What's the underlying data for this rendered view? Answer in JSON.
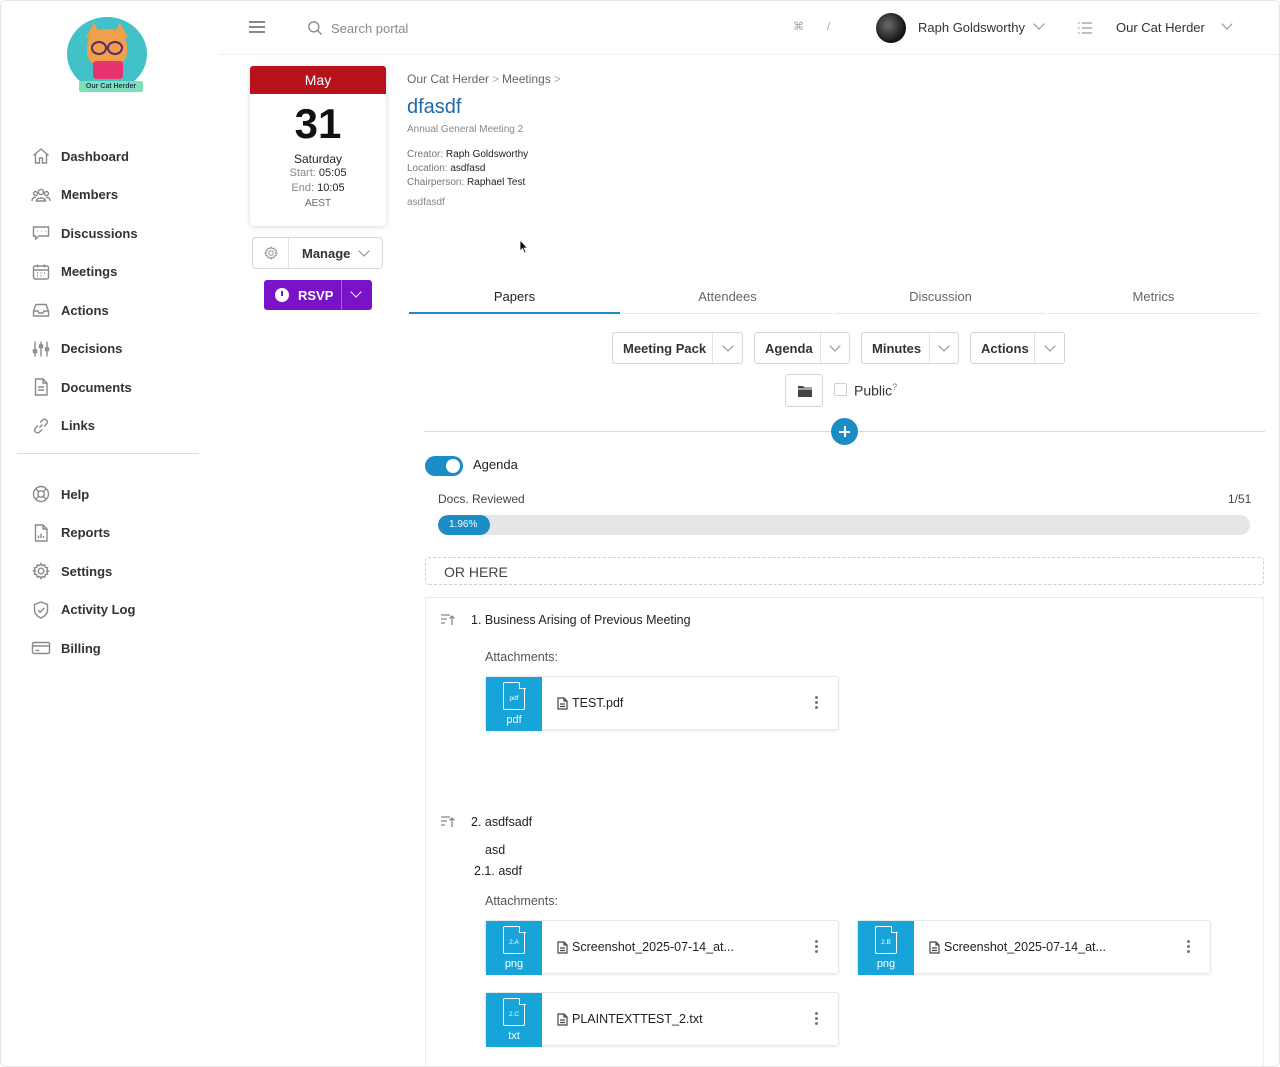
{
  "app": {
    "name": "Our Cat Herder"
  },
  "topbar": {
    "search_placeholder": "Search portal",
    "shortcut": "⌘ /",
    "user_name": "Raph Goldsworthy",
    "org_name": "Our Cat Herder"
  },
  "sidebar": {
    "logo_text": "Our Cat Herder",
    "primary": [
      {
        "label": "Dashboard",
        "icon": "home-icon"
      },
      {
        "label": "Members",
        "icon": "members-icon"
      },
      {
        "label": "Discussions",
        "icon": "chat-icon"
      },
      {
        "label": "Meetings",
        "icon": "calendar-icon"
      },
      {
        "label": "Actions",
        "icon": "inbox-icon"
      },
      {
        "label": "Decisions",
        "icon": "sliders-icon"
      },
      {
        "label": "Documents",
        "icon": "document-icon"
      },
      {
        "label": "Links",
        "icon": "link-icon"
      }
    ],
    "secondary": [
      {
        "label": "Help",
        "icon": "lifebuoy-icon"
      },
      {
        "label": "Reports",
        "icon": "report-icon"
      },
      {
        "label": "Settings",
        "icon": "gear-icon"
      },
      {
        "label": "Activity Log",
        "icon": "shield-icon"
      },
      {
        "label": "Billing",
        "icon": "credit-card-icon"
      }
    ]
  },
  "calendar": {
    "month": "May",
    "day": "31",
    "weekday": "Saturday",
    "start_label": "Start:",
    "start": "05:05",
    "end_label": "End:",
    "end": "10:05",
    "timezone": "AEST"
  },
  "buttons": {
    "manage": "Manage",
    "rsvp": "RSVP"
  },
  "meeting": {
    "breadcrumb": [
      "Our Cat Herder",
      "Meetings"
    ],
    "title": "dfasdf",
    "subtitle": "Annual General Meeting 2",
    "creator_label": "Creator:",
    "creator": "Raph Goldsworthy",
    "location_label": "Location:",
    "location": "asdfasd",
    "chair_label": "Chairperson:",
    "chair": "Raphael Test",
    "description": "asdfasdf"
  },
  "tabs": [
    {
      "label": "Papers",
      "active": true
    },
    {
      "label": "Attendees",
      "active": false
    },
    {
      "label": "Discussion",
      "active": false
    },
    {
      "label": "Metrics",
      "active": false
    }
  ],
  "doc_buttons": [
    "Meeting Pack",
    "Agenda",
    "Minutes",
    "Actions"
  ],
  "public": {
    "label": "Public",
    "help": "?",
    "checked": false
  },
  "agenda_toggle": {
    "label": "Agenda",
    "on": true
  },
  "progress": {
    "label": "Docs. Reviewed",
    "count": "1/51",
    "percent_text": "1.96%",
    "percent": 1.96
  },
  "drop_zone": "OR HERE",
  "agenda_items": [
    {
      "title": "1. Business Arising of Previous Meeting",
      "attachments_label": "Attachments:",
      "files": [
        {
          "tag": "pdf",
          "ext": "pdf",
          "name": "TEST.pdf"
        }
      ]
    },
    {
      "title": "2. asdfsadf",
      "text": "asd",
      "subitem": "2.1. asdf",
      "attachments_label": "Attachments:",
      "files": [
        {
          "tag": "2.A",
          "ext": "png",
          "name": "Screenshot_2025-07-14_at..."
        },
        {
          "tag": "2.B",
          "ext": "png",
          "name": "Screenshot_2025-07-14_at..."
        },
        {
          "tag": "2.C",
          "ext": "txt",
          "name": "PLAINTEXTTEST_2.txt"
        }
      ]
    }
  ],
  "colors": {
    "accent": "#1a8dc7",
    "calendar_header": "#b5121b",
    "rsvp": "#7a12c8",
    "file_thumb": "#17a4d9",
    "title_link": "#1c6aa8"
  }
}
